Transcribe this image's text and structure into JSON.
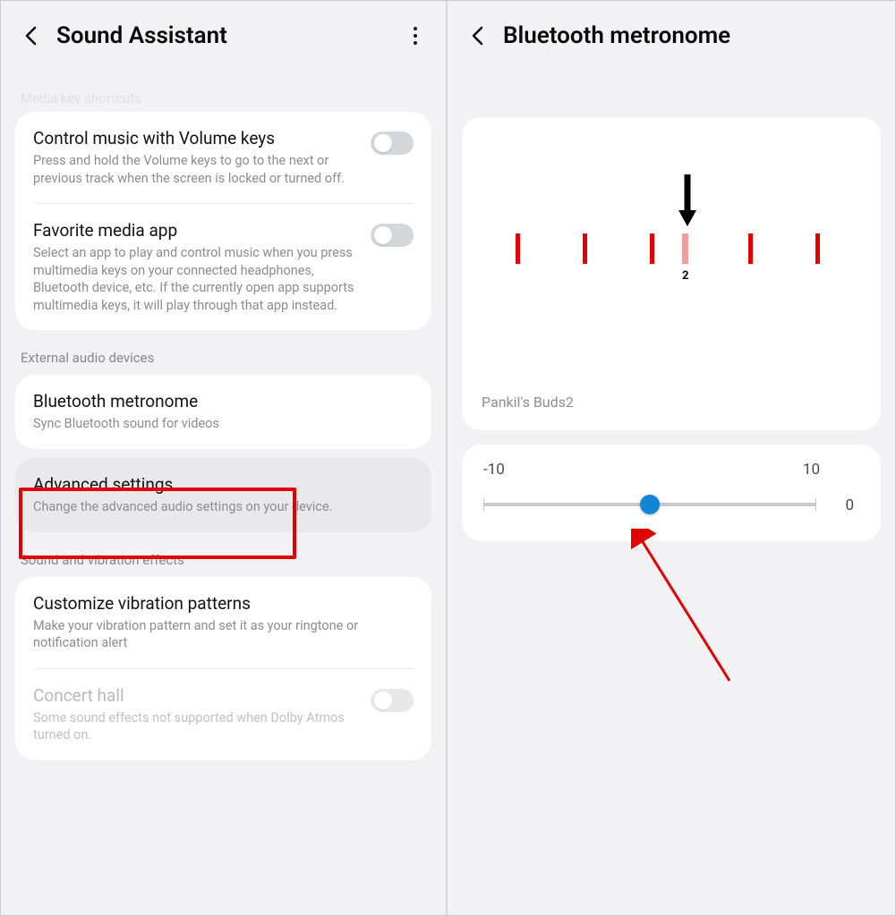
{
  "left": {
    "title": "Sound Assistant",
    "fade_top": "Media key shortcuts",
    "item_music": {
      "title": "Control music with Volume keys",
      "sub": "Press and hold the Volume keys to go to the next or previous track when the screen is locked or turned off."
    },
    "item_fav": {
      "title": "Favorite media app",
      "sub": "Select an app to play and control music when you press multimedia keys on your connected headphones, Bluetooth device, etc. If the currently open app supports multimedia keys, it will play through that app instead."
    },
    "section_external": "External audio devices",
    "item_bt": {
      "title": "Bluetooth metronome",
      "sub": "Sync Bluetooth sound for videos"
    },
    "item_adv": {
      "title": "Advanced settings",
      "sub": "Change the advanced audio settings on your device."
    },
    "section_sound": "Sound and vibration effects",
    "item_vib": {
      "title": "Customize vibration patterns",
      "sub": "Make your vibration pattern and set it as your ringtone or notification alert"
    },
    "item_concert": {
      "title": "Concert hall",
      "sub": "Some sound effects not supported when Dolby Atmos turned on."
    }
  },
  "right": {
    "title": "Bluetooth metronome",
    "scale_label": "2",
    "device": "Pankil's Buds2",
    "slider": {
      "min": "-10",
      "max": "10",
      "value": "0"
    }
  },
  "colors": {
    "accent_red": "#e30000",
    "accent_blue": "#1185d8"
  }
}
